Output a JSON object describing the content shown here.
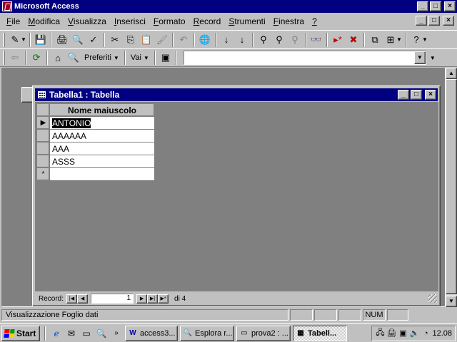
{
  "window": {
    "title": "Microsoft Access"
  },
  "window_controls": {
    "minimize": "_",
    "maximize": "□",
    "close": "×"
  },
  "menu": {
    "items": [
      {
        "label": "File",
        "hotkey": "F",
        "rest": "ile"
      },
      {
        "label": "Modifica",
        "hotkey": "M",
        "rest": "odifica"
      },
      {
        "label": "Visualizza",
        "hotkey": "V",
        "rest": "isualizza"
      },
      {
        "label": "Inserisci",
        "hotkey": "I",
        "rest": "nserisci"
      },
      {
        "label": "Formato",
        "hotkey": "F",
        "rest": "ormato"
      },
      {
        "label": "Record",
        "hotkey": "R",
        "rest": "ecord"
      },
      {
        "label": "Strumenti",
        "hotkey": "S",
        "rest": "trumenti"
      },
      {
        "label": "Finestra",
        "hotkey": "F",
        "rest": "inestra",
        "pre": ""
      },
      {
        "label": "?",
        "hotkey": "?",
        "rest": ""
      }
    ]
  },
  "toolbar1": {
    "icons": [
      "✎",
      "💾",
      "🖨",
      "🔍",
      "✓",
      "✂",
      "⎘",
      "📋",
      "🖌",
      "↶",
      "🌐",
      "↓",
      "↓",
      "⚲",
      "⚲",
      "⚲",
      "👓",
      "▸*",
      "✖",
      "⧉",
      "⊞",
      "?"
    ]
  },
  "toolbar2": {
    "back_icon": "⇦",
    "refresh_icon": "⟳",
    "home_icon": "⌂",
    "search_icon": "🔍",
    "favorites_label": "Preferiti",
    "go_label": "Vai",
    "show_icon": "▣",
    "address_value": ""
  },
  "table_window": {
    "title": "Tabella1 : Tabella",
    "column_header": "Nome maiuscolo",
    "rows": [
      "ANTONIO",
      "AAAAAA",
      "AAA",
      "ASSS",
      ""
    ],
    "selectors": [
      "▶",
      "",
      "",
      "",
      "*"
    ]
  },
  "record_nav": {
    "label": "Record:",
    "current": "1",
    "total": "di 4",
    "first": "|◀",
    "prev": "◀",
    "next": "▶",
    "last": "▶|",
    "new": "▶*"
  },
  "status": {
    "text": "Visualizzazione Foglio dati",
    "num": "NUM"
  },
  "taskbar": {
    "start_label": "Start",
    "tasks": [
      {
        "icon": "W",
        "label": "access3..."
      },
      {
        "icon": "🔍",
        "label": "Esplora r..."
      },
      {
        "icon": "▭",
        "label": "prova2 : ..."
      },
      {
        "icon": "▦",
        "label": "Tabell...",
        "active": true
      }
    ],
    "clock": "12.08"
  },
  "colors": {
    "titlebar": "#000080",
    "face": "#c0c0c0",
    "mdi_background": "#808080",
    "winlogo_red": "#ff0000",
    "winlogo_green": "#00a000",
    "winlogo_blue": "#0000ff",
    "winlogo_yellow": "#ffd000"
  }
}
